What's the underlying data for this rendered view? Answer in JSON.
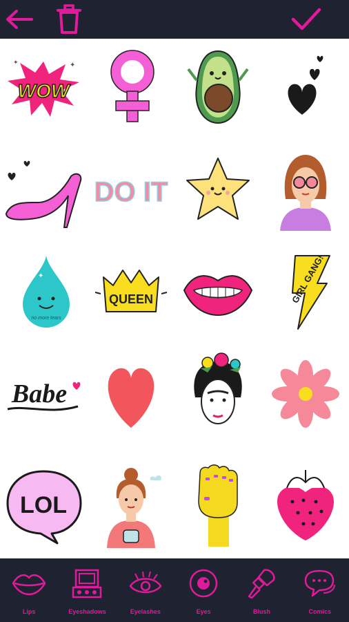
{
  "header": {
    "back_icon": "arrow-left-icon",
    "delete_icon": "trash-icon",
    "confirm_icon": "checkmark-icon"
  },
  "stickers": {
    "wow": "WOW",
    "doit": "DO IT",
    "queen": "QUEEN",
    "girlgang": "GIRL GANG!",
    "babe": "Babe",
    "lol": "LOL",
    "drop_caption": "no more tears"
  },
  "bottom_nav": {
    "items": [
      {
        "label": "Lips",
        "icon": "lips-icon"
      },
      {
        "label": "Eyeshadows",
        "icon": "eyeshadow-palette-icon"
      },
      {
        "label": "Eyelashes",
        "icon": "eyelash-icon"
      },
      {
        "label": "Eyes",
        "icon": "eye-icon"
      },
      {
        "label": "Blush",
        "icon": "brush-icon"
      },
      {
        "label": "Comics",
        "icon": "speech-bubble-icon"
      }
    ]
  },
  "colors": {
    "accent": "#e01a9a",
    "bar_bg": "#1f2230"
  }
}
